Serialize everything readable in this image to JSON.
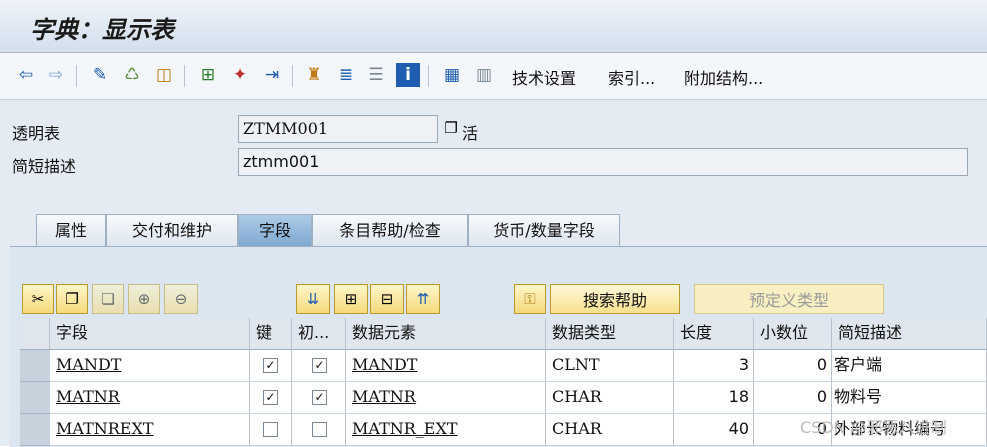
{
  "window": {
    "title": "字典：显示表"
  },
  "toolbar": {
    "icons": [
      "back-arrow-icon",
      "forward-arrow-icon",
      "glasses-pencil-icon",
      "objects-icon",
      "activate-icon",
      "hierarchy-icon",
      "magic-wand-icon",
      "move-icon",
      "tree-icon",
      "layers-icon",
      "list-icon",
      "info-icon",
      "columns-icon",
      "grid-icon"
    ],
    "text_buttons": [
      "技术设置",
      "索引...",
      "附加结构..."
    ]
  },
  "header": {
    "transparent_table_label": "透明表",
    "transparent_table_value": "ZTMM001",
    "status_suffix": "活",
    "short_desc_label": "简短描述",
    "short_desc_value": "ztmm001"
  },
  "tabs": [
    "属性",
    "交付和维护",
    "字段",
    "条目帮助/检查",
    "货币/数量字段"
  ],
  "active_tab": "字段",
  "table_toolbar": {
    "search_help_label": "搜索帮助",
    "predefined_type_label": "预定义类型"
  },
  "grid": {
    "columns": [
      "字段",
      "键",
      "初...",
      "数据元素",
      "数据类型",
      "长度",
      "小数位",
      "简短描述"
    ],
    "rows": [
      {
        "field": "MANDT",
        "key": true,
        "init": true,
        "element": "MANDT",
        "type": "CLNT",
        "length": "3",
        "decimals": "0",
        "desc": "客户端"
      },
      {
        "field": "MATNR",
        "key": true,
        "init": true,
        "element": "MATNR",
        "type": "CHAR",
        "length": "18",
        "decimals": "0",
        "desc": "物料号"
      },
      {
        "field": "MATNREXT",
        "key": false,
        "init": false,
        "element": "MATNR_EXT",
        "type": "CHAR",
        "length": "40",
        "decimals": "0",
        "desc": "外部长物料编号"
      }
    ]
  },
  "watermark": "CSDN @邪恶八进制"
}
